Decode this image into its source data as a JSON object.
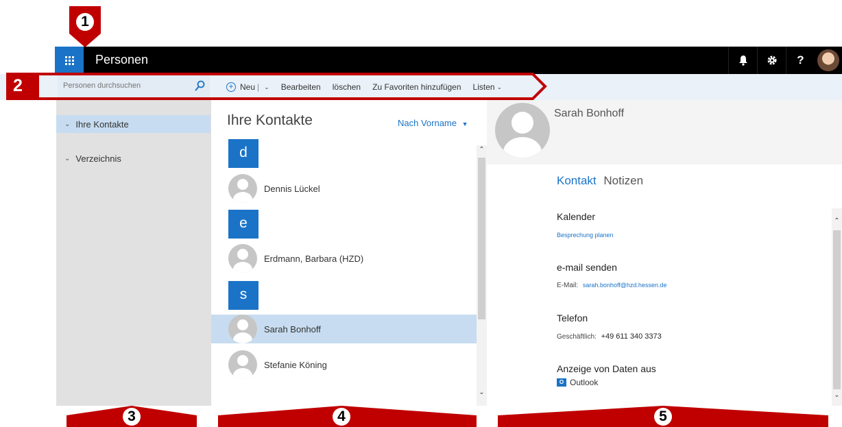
{
  "callouts": {
    "c1": "1",
    "c2": "2",
    "c3": "3",
    "c4": "4",
    "c5": "5"
  },
  "header": {
    "app_title": "Personen",
    "icons": [
      "bell-icon",
      "gear-icon",
      "help-icon",
      "user-avatar"
    ],
    "help_glyph": "?"
  },
  "search": {
    "placeholder": "Personen durchsuchen"
  },
  "toolbar": {
    "new_label": "Neu",
    "separator": "|",
    "edit_label": "Bearbeiten",
    "delete_label": "löschen",
    "favorites_label": "Zu Favoriten hinzufügen",
    "lists_label": "Listen"
  },
  "sidebar": {
    "items": [
      {
        "label": "Ihre Kontakte",
        "selected": true
      },
      {
        "label": "Verzeichnis",
        "selected": false
      }
    ]
  },
  "list": {
    "title": "Ihre Kontakte",
    "sort_label": "Nach Vorname",
    "groups": [
      {
        "letter": "d",
        "contacts": [
          "Dennis Lückel"
        ]
      },
      {
        "letter": "e",
        "contacts": [
          "Erdmann, Barbara (HZD)"
        ]
      },
      {
        "letter": "s",
        "contacts": [
          "Sarah Bonhoff",
          "Stefanie Köning"
        ]
      }
    ],
    "selected_contact": "Sarah Bonhoff"
  },
  "detail": {
    "name": "Sarah Bonhoff",
    "tabs": [
      "Kontakt",
      "Notizen"
    ],
    "calendar": {
      "title": "Kalender",
      "link": "Besprechung planen"
    },
    "email": {
      "title": "e-mail senden",
      "label": "E-Mail:",
      "value": "sarah.bonhoff@hzd.hessen.de"
    },
    "phone": {
      "title": "Telefon",
      "label": "Geschäftlich:",
      "value": "+49 611 340 3373"
    },
    "source": {
      "title": "Anzeige von Daten aus",
      "label": "Outlook",
      "icon_letter": "O"
    }
  },
  "colors": {
    "accent": "#1a73c7",
    "annotation_red": "#c00000",
    "topbar": "#000000"
  }
}
